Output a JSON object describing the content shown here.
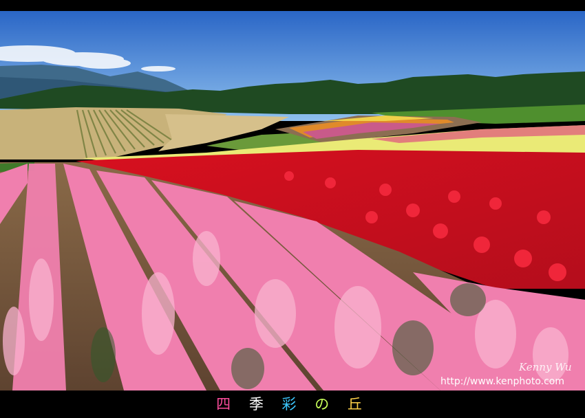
{
  "title_chars": [
    "四",
    "季",
    "彩",
    "の",
    "丘"
  ],
  "colors": {
    "frame": "#000000",
    "sky_top": "#2a66c6",
    "sky_bottom": "#8fc0ee",
    "treeline": "#1f4a22",
    "field_tan": "#c8b27a",
    "red_flowers": "#e3122a",
    "yellow_flowers": "#f0ee6a",
    "pink_flowers": "#f07fae",
    "soil": "#7a5a3e"
  },
  "caption_colors": [
    "#ff4d9d",
    "#ffffff",
    "#3cc7ff",
    "#c8ff5a",
    "#ffd24a"
  ],
  "signature": "Kenny Wu",
  "url": "http://www.kenphoto.com"
}
